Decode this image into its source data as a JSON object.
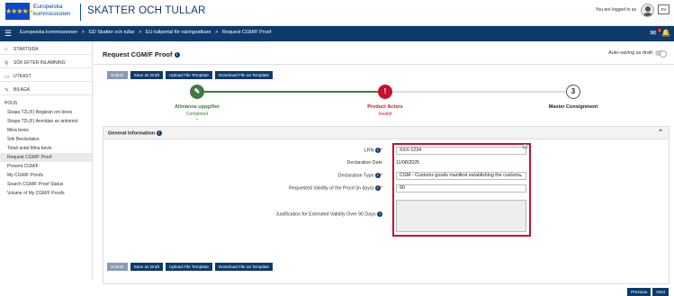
{
  "header": {
    "eu_name_line1": "Europeiska",
    "eu_name_line2": "kommissionen",
    "app_title": "SKATTER OCH TULLAR",
    "login_text": "You are logged in as",
    "lang_code": "SV",
    "flag_stars": "★★★★★"
  },
  "nav": {
    "menu_glyph": "☰",
    "crumbs": [
      "Europeiska kommissionen",
      ">",
      "GD Skatter och tullar",
      ">",
      "EU-tullportal för näringsidkare",
      ">",
      "Request CGM/F Proof"
    ],
    "notification_count": "8",
    "bell_glyph": "🔔"
  },
  "sidebar": {
    "top_items": [
      {
        "label": "STARTSIDA",
        "icon": "home-icon",
        "glyph": "⌂"
      },
      {
        "label": "SÖK EFTER INLAMNING",
        "icon": "search-icon",
        "glyph": "⚲"
      },
      {
        "label": "UTKAST",
        "icon": "document-icon",
        "glyph": "▭"
      },
      {
        "label": "BILAGA",
        "icon": "paperclip-icon",
        "glyph": "✎"
      }
    ],
    "section": "POUS",
    "items": [
      "Skapa T2L(F) Begäran om bevis",
      "Skapa T2L(F) Anmälan av ankomst",
      "Mina bevis",
      "Sök Bevisstatus",
      "Totalt antal Mina bevis",
      "Request CGM/F Proof",
      "Present CGM/F",
      "My CGM/F Proofs",
      "Search CGM/F Proof Status",
      "Volume of My CGM/F Proofs"
    ],
    "active_index": 5
  },
  "page": {
    "title": "Request CGM/F Proof",
    "autosave_label": "Auto-saving as draft",
    "toolbar": {
      "submit": "Submit",
      "save_draft": "Save as Draft",
      "upload": "Upload File Template",
      "download": "Download File as Template"
    }
  },
  "steps": [
    {
      "number": "✎",
      "label": "Allmänna uppgifter",
      "status": "Completed",
      "color": "#3f7b3f"
    },
    {
      "number": "!",
      "label": "Product Actors",
      "status": "Invalid",
      "color": "#c8102e"
    },
    {
      "number": "3",
      "label": "Master Consignment",
      "status": "",
      "color": "#222222"
    }
  ],
  "general": {
    "heading": "General Information",
    "lrn_label": "LRN",
    "lrn_value": "XXX-1234",
    "date_label": "Declaration Date",
    "date_value": "11/08/2025",
    "type_label": "Declaration Type",
    "type_value": "CGM - Customs goods manifest establishing the customs",
    "validity_label": "Requested Validity of the Proof (in days)",
    "validity_value": "90",
    "justification_label": "Justification for Extended Validity Over 90 Days"
  },
  "footer_nav": {
    "previous": "Previous",
    "next": "Next"
  },
  "colors": {
    "brand": "#0e3a6c",
    "completed": "#3f7b3f",
    "invalid": "#c8102e"
  }
}
